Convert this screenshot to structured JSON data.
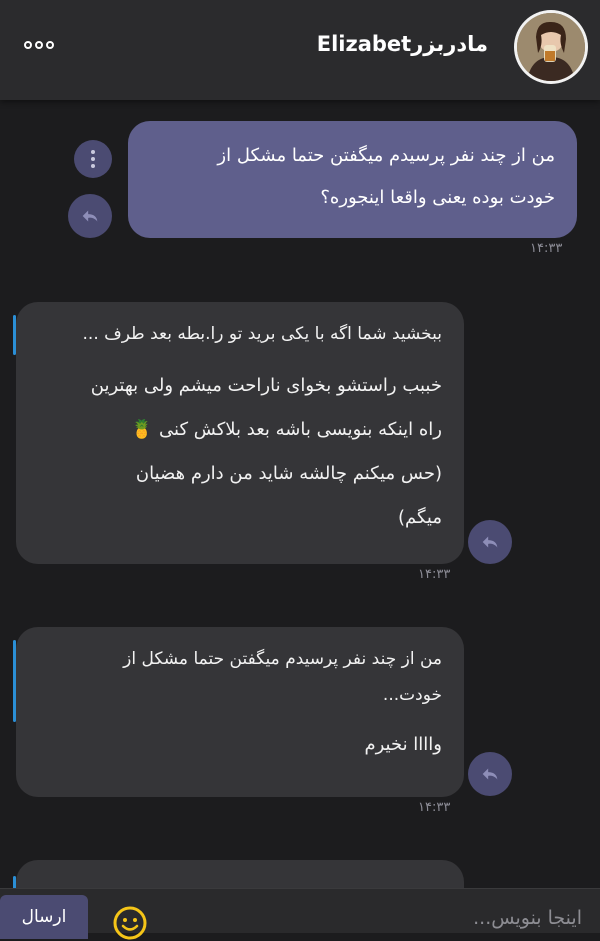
{
  "header": {
    "title": "مادربزرElizabet",
    "avatar": "avatar-photo",
    "menu_icon": "more-dots-icon"
  },
  "messages": [
    {
      "type": "outgoing",
      "lines": [
        "من از چند نفر پرسیدم میگفتن حتما مشکل از",
        "خودت بوده یعنی واقعا اینجوره؟"
      ],
      "time": "۱۴:۳۳"
    },
    {
      "type": "incoming",
      "quote": "ببخشید شما اگه با یکی برید تو را.بطه بعد طرف ...",
      "lines": [
        "خببب راستشو بخوای ناراحت میشم ولی بهترین",
        "راه اینکه بنویسی باشه بعد بلاکش کنی 🍍",
        "(حس میکنم چالشه شاید من دارم هضیان",
        "میگم)"
      ],
      "time": "۱۴:۳۳"
    },
    {
      "type": "incoming",
      "quote_lines": [
        "من از چند نفر پرسیدم میگفتن حتما مشکل از",
        "خودت..."
      ],
      "lines": [
        "واااا نخیرم"
      ],
      "time": "۱۴:۳۳"
    }
  ],
  "input": {
    "placeholder": "اینجا بنویس...",
    "value": ""
  },
  "send_label": "ارسال",
  "colors": {
    "background": "#1c1c1e",
    "header": "#2b2b2d",
    "outgoing_bubble": "#5f5f8c",
    "incoming_bubble": "#353538",
    "quote_bar": "#2b8fd6",
    "emoji": "#f5c518"
  }
}
